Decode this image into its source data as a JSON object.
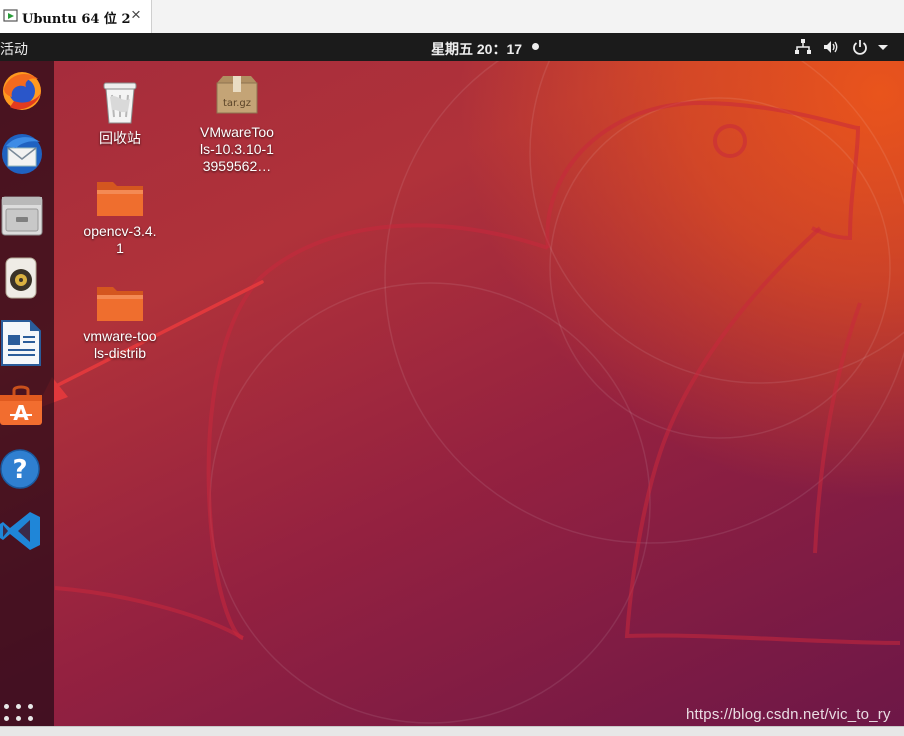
{
  "window": {
    "tab_title": "Ubuntu 64 位 2",
    "tab_close": "×"
  },
  "topbar": {
    "activities": "活动",
    "clock": "星期五 20：17"
  },
  "dock": {
    "items": [
      {
        "icon": "firefox-icon",
        "app": "Firefox"
      },
      {
        "icon": "thunderbird-icon",
        "app": "Thunderbird"
      },
      {
        "icon": "files-icon",
        "app": "Files"
      },
      {
        "icon": "rhythmbox-icon",
        "app": "Rhythmbox"
      },
      {
        "icon": "libreoffice-writer-icon",
        "app": "LibreOffice Writer"
      },
      {
        "icon": "ubuntu-software-icon",
        "app": "Ubuntu Software"
      },
      {
        "icon": "help-icon",
        "app": "Help"
      },
      {
        "icon": "vscode-icon",
        "app": "Visual Studio Code"
      }
    ],
    "show_apps_icon": "apps-grid-icon"
  },
  "desktop": {
    "trash_label": "回收站",
    "archive_badge": "tar.gz",
    "archive_label": "VMwareTools-10.3.10-13959562…",
    "opencv_label": "opencv-3.4.1",
    "vmware_label": "vmware-tools-distrib"
  },
  "watermark": "https://blog.csdn.net/vic_to_ry",
  "colors": {
    "accent_orange": "#e9541c",
    "wallpaper_purple": "#7a1b45",
    "annotation_red": "#e0383c"
  }
}
